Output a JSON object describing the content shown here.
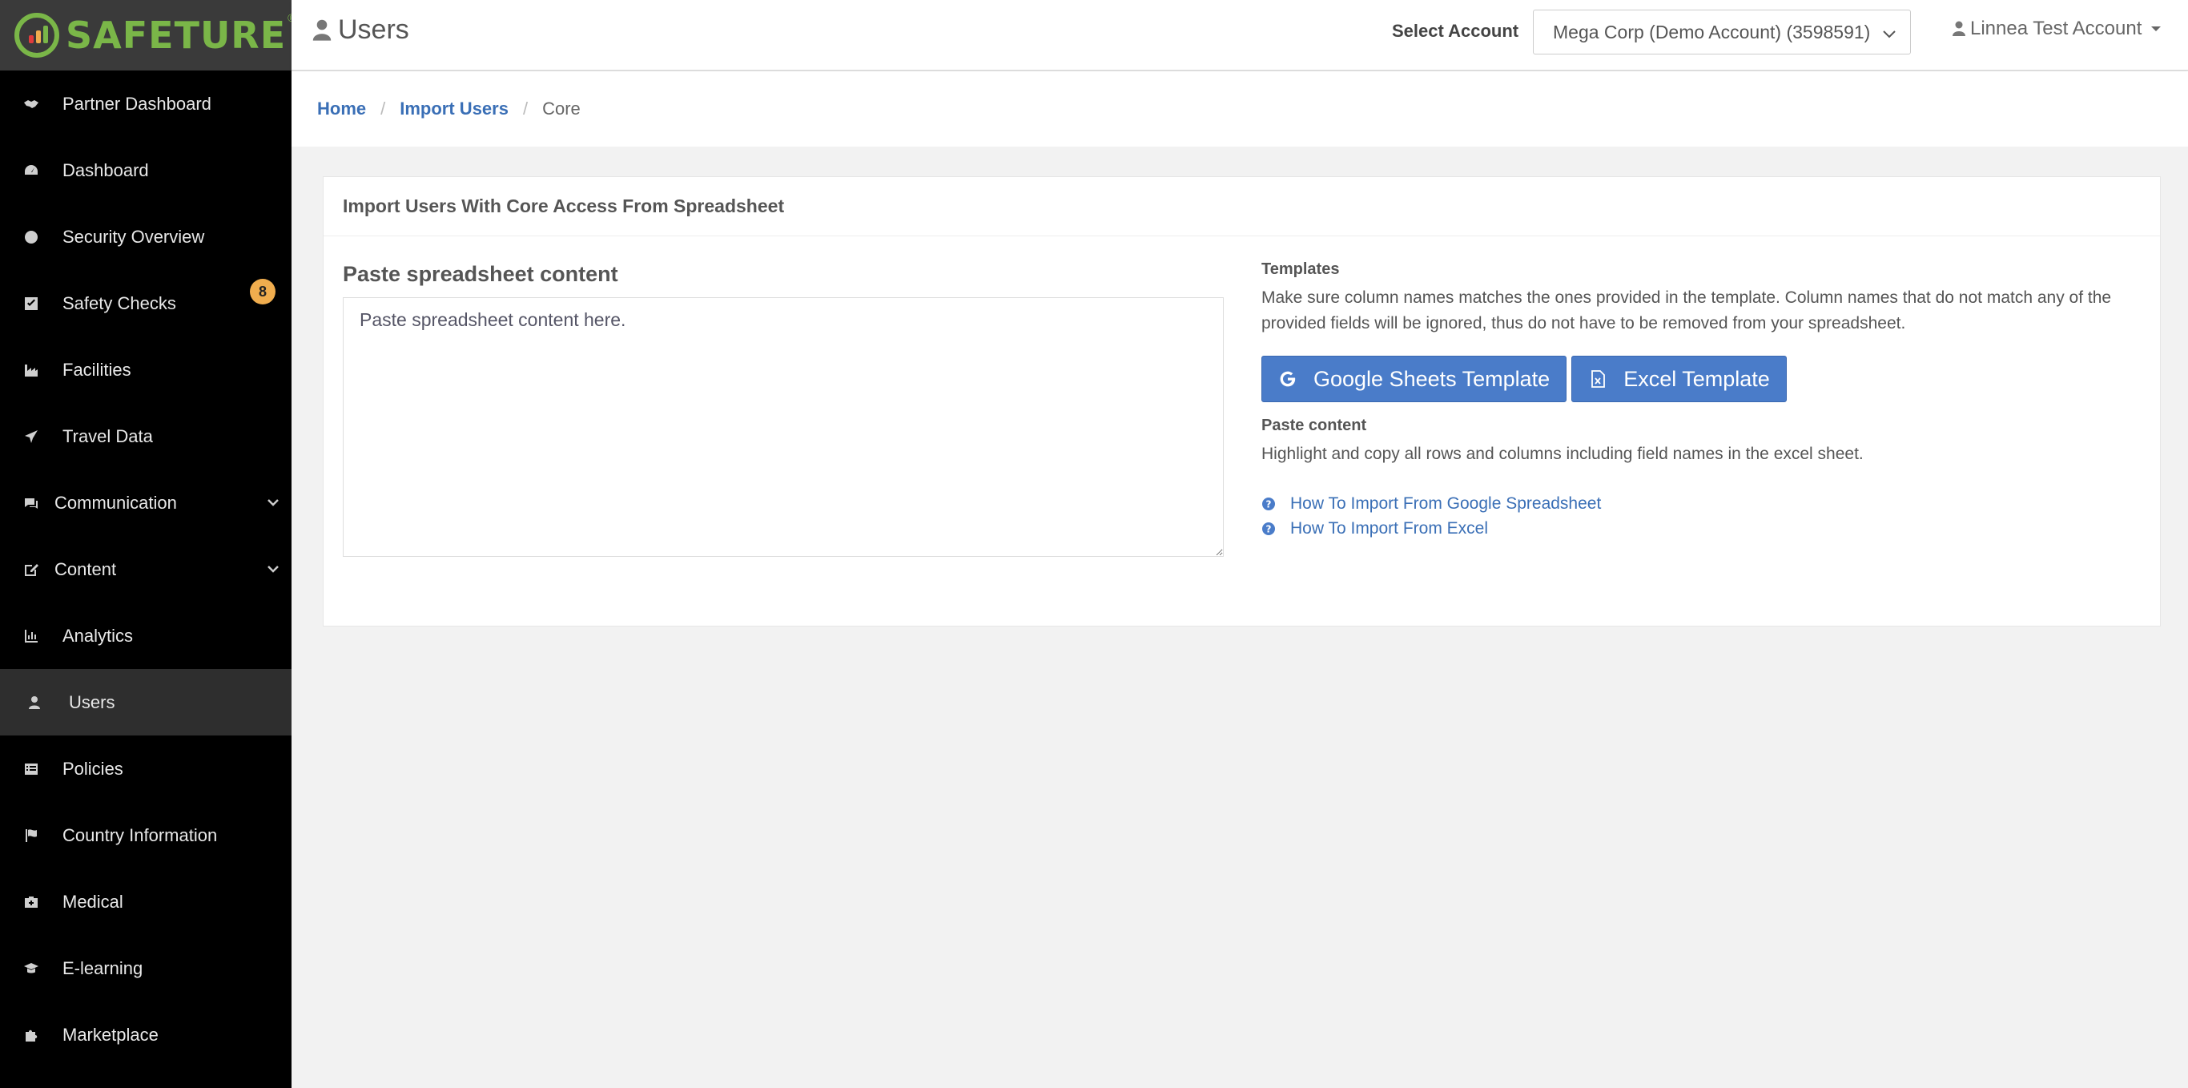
{
  "brand": {
    "name": "SAFETURE",
    "reg": "®",
    "accent": "#7ab648"
  },
  "sidebar": {
    "items": [
      {
        "label": "Partner Dashboard",
        "icon": "handshake-icon"
      },
      {
        "label": "Dashboard",
        "icon": "dashboard-icon"
      },
      {
        "label": "Security Overview",
        "icon": "globe-icon"
      },
      {
        "label": "Safety Checks",
        "icon": "check-square-icon",
        "badge": "8"
      },
      {
        "label": "Facilities",
        "icon": "industry-icon"
      },
      {
        "label": "Travel Data",
        "icon": "plane-icon"
      },
      {
        "label": "Communication",
        "icon": "comments-icon"
      },
      {
        "label": "Content",
        "icon": "edit-icon"
      },
      {
        "label": "Analytics",
        "icon": "bar-chart-icon"
      },
      {
        "label": "Users",
        "icon": "user-icon"
      },
      {
        "label": "Policies",
        "icon": "list-icon"
      },
      {
        "label": "Country Information",
        "icon": "flag-icon"
      },
      {
        "label": "Medical",
        "icon": "medkit-icon"
      },
      {
        "label": "E-learning",
        "icon": "graduation-cap-icon"
      },
      {
        "label": "Marketplace",
        "icon": "puzzle-icon"
      }
    ],
    "active": "Users",
    "badge_color": "#f0ad4e"
  },
  "header": {
    "title": "Users",
    "select_label": "Select Account",
    "account_value": "Mega Corp (Demo Account) (3598591)",
    "user_name": "Linnea Test Account"
  },
  "breadcrumb": {
    "home": "Home",
    "import": "Import Users",
    "current": "Core",
    "sep": "/"
  },
  "panel": {
    "heading": "Import Users With Core Access From Spreadsheet",
    "paste_label": "Paste spreadsheet content",
    "paste_placeholder": "Paste spreadsheet content here.",
    "templates_title": "Templates",
    "templates_text": "Make sure column names matches the ones provided in the template. Column names that do not match any of the provided fields will be ignored, thus do not have to be removed from your spreadsheet.",
    "google_btn": "Google Sheets Template",
    "excel_btn": "Excel Template",
    "paste_content_title": "Paste content",
    "paste_content_text": "Highlight and copy all rows and columns including field names in the excel sheet.",
    "link_google": "How To Import From Google Spreadsheet",
    "link_excel": "How To Import From Excel",
    "button_color": "#4a7cc9",
    "link_color": "#3a6fb6"
  }
}
